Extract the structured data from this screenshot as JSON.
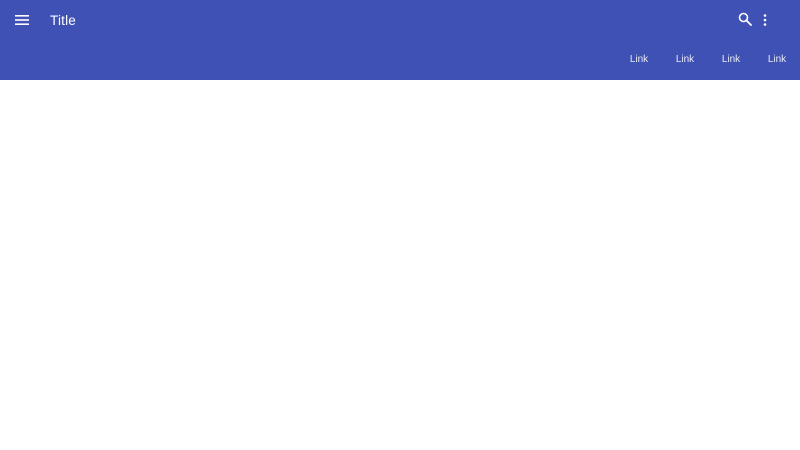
{
  "colors": {
    "appbar": "#3f51b5",
    "appbar_text": "#ffffff",
    "link_text": "#e8eaf6",
    "content_bg": "#ffffff"
  },
  "appbar": {
    "menu_icon": "menu-icon",
    "title": "Title",
    "search_icon": "search-icon",
    "more_icon": "more-vert-icon",
    "links": [
      {
        "label": "Link"
      },
      {
        "label": "Link"
      },
      {
        "label": "Link"
      },
      {
        "label": "Link"
      }
    ]
  }
}
